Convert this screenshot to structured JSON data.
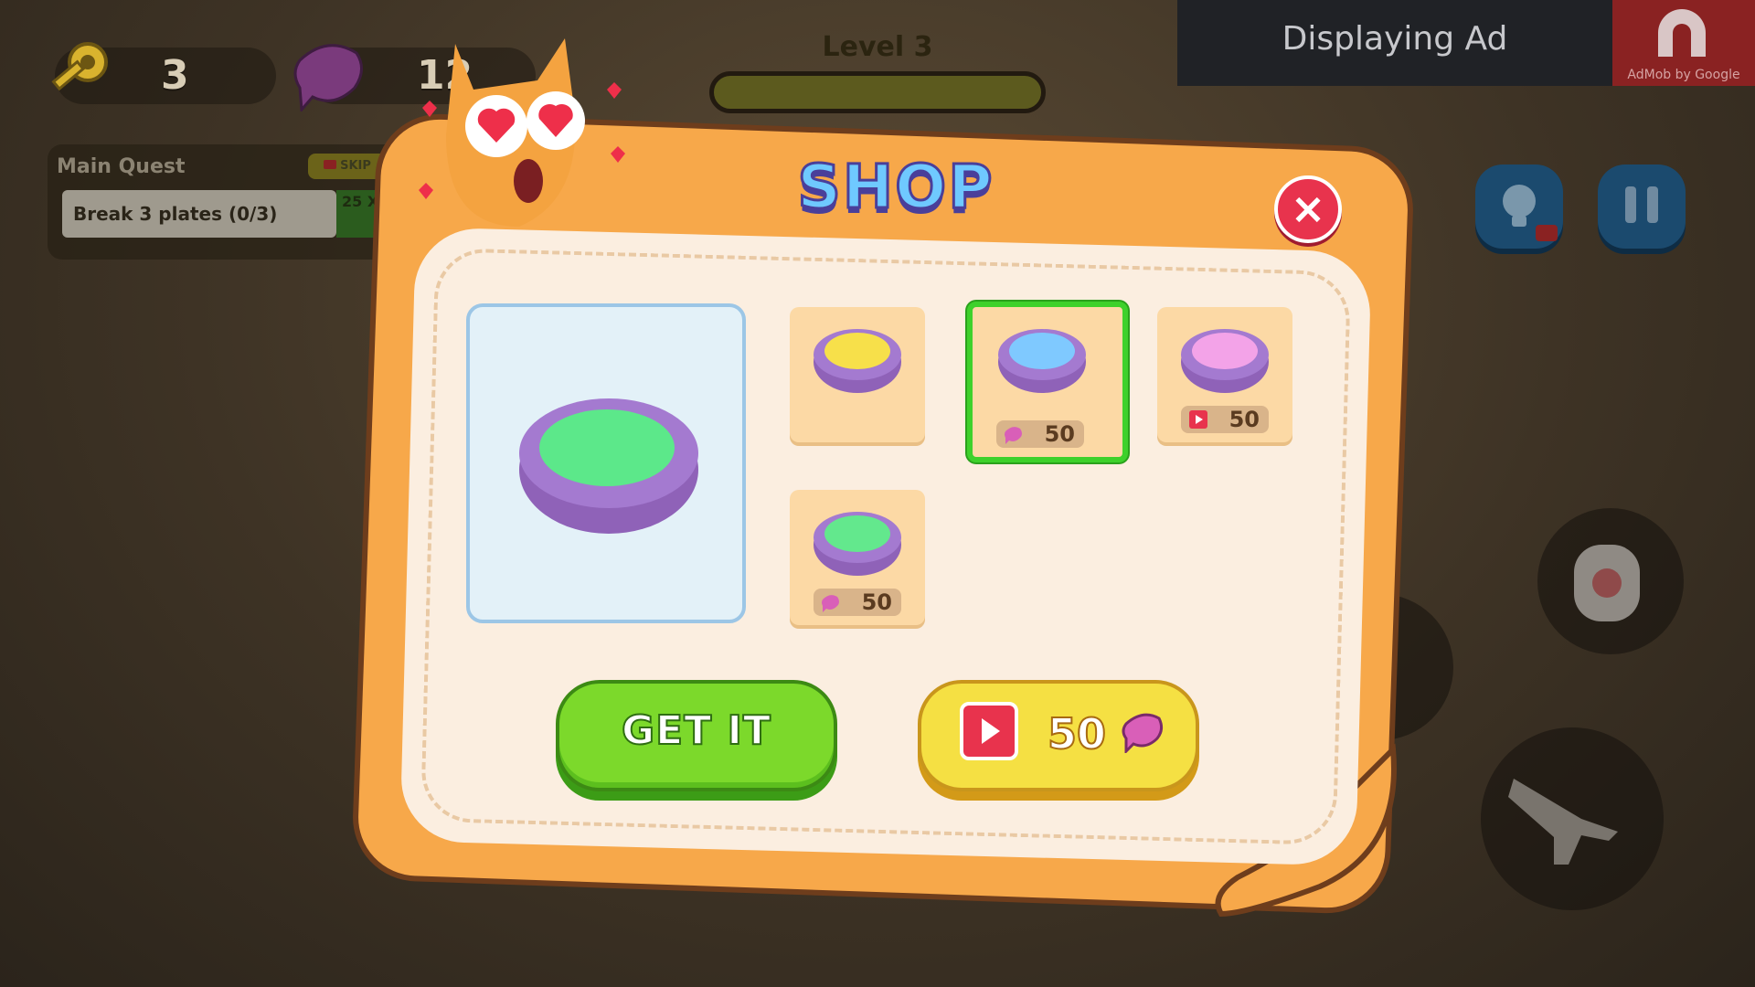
{
  "hud": {
    "keys": "3",
    "fish": "12",
    "level": "Level 3",
    "level_progress": 0.0
  },
  "ad_banner": {
    "text": "Displaying Ad",
    "brand": "AdMob by Google"
  },
  "quest": {
    "title": "Main Quest",
    "skip_label": "SKIP",
    "task": "Break 3 plates (0/3)",
    "reward_partial": "25 X"
  },
  "shop": {
    "title": "SHOP",
    "close_label": "×",
    "items": [
      {
        "color": "#f7e04a",
        "price": "",
        "currency": "none",
        "selected": false
      },
      {
        "color": "#7fc9ff",
        "price": "50",
        "currency": "fish",
        "selected": true
      },
      {
        "color": "#f3a3e8",
        "price": "50",
        "currency": "video",
        "selected": false
      },
      {
        "color": "#63e88d",
        "price": "50",
        "currency": "fish",
        "selected": false
      }
    ],
    "preview_color": "#5ce88a",
    "get_button": "GET IT",
    "ad_button_price": "50"
  },
  "colors": {
    "bowl": "#9a6ac4",
    "accent_green": "#7cd92b",
    "accent_yellow": "#f5e043",
    "panel": "#f7a84a"
  }
}
